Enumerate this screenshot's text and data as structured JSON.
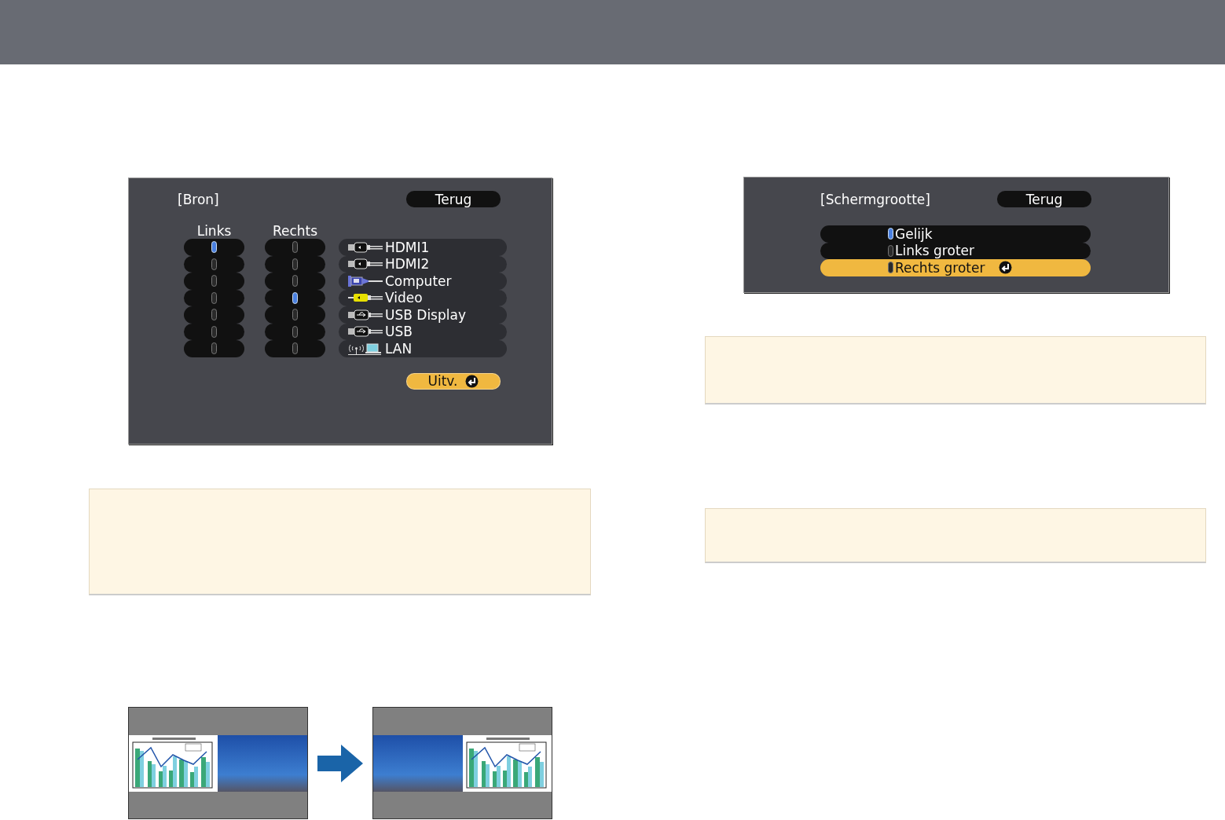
{
  "source_menu": {
    "title": "[Bron]",
    "back_button": "Terug",
    "columns": [
      "Links",
      "Rechts"
    ],
    "sources": [
      {
        "label": "HDMI1",
        "kind": "hdmi",
        "left_selected": true,
        "right_selected": false
      },
      {
        "label": "HDMI2",
        "kind": "hdmi",
        "left_selected": false,
        "right_selected": false
      },
      {
        "label": "Computer",
        "kind": "vga",
        "left_selected": false,
        "right_selected": false
      },
      {
        "label": "Video",
        "kind": "rca",
        "left_selected": false,
        "right_selected": true
      },
      {
        "label": "USB Display",
        "kind": "usb",
        "left_selected": false,
        "right_selected": false
      },
      {
        "label": "USB",
        "kind": "usb",
        "left_selected": false,
        "right_selected": false
      },
      {
        "label": "LAN",
        "kind": "lan",
        "left_selected": false,
        "right_selected": false
      }
    ],
    "exit_button": "Uitv."
  },
  "screen_size_menu": {
    "title": "[Schermgrootte]",
    "back_button": "Terug",
    "options": [
      {
        "label": "Gelijk",
        "checked": true,
        "selected": false
      },
      {
        "label": "Links groter",
        "checked": false,
        "selected": false
      },
      {
        "label": "Rechts groter",
        "checked": false,
        "selected": true
      }
    ]
  },
  "illustration": {
    "panels": [
      {
        "chart_on_right": false
      },
      {
        "chart_on_right": true
      }
    ]
  }
}
